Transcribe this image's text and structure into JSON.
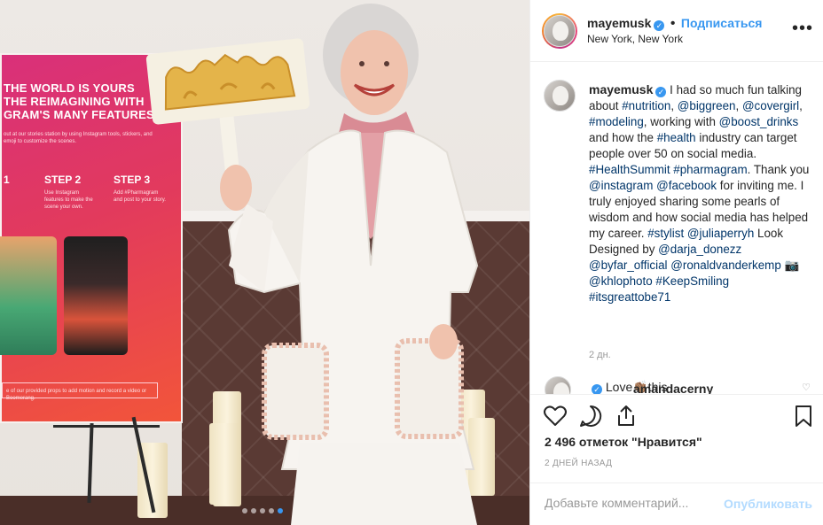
{
  "post": {
    "username": "mayemusk",
    "follow_label": "Подписаться",
    "separator": "•",
    "location": "New York, New York",
    "more_label": "•••"
  },
  "caption": {
    "username": "mayemusk",
    "segments": [
      {
        "t": "I had so much fun talking about "
      },
      {
        "t": "#nutrition",
        "link": true
      },
      {
        "t": ", "
      },
      {
        "t": "@biggreen",
        "link": true
      },
      {
        "t": ", "
      },
      {
        "t": "@covergirl",
        "link": true
      },
      {
        "t": ", "
      },
      {
        "t": "#modeling",
        "link": true
      },
      {
        "t": ", working with "
      },
      {
        "t": "@boost_drinks",
        "link": true
      },
      {
        "t": " and how the "
      },
      {
        "t": "#health",
        "link": true
      },
      {
        "t": " industry can target people over 50 on social media. "
      },
      {
        "t": "#HealthSummit",
        "link": true
      },
      {
        "t": " "
      },
      {
        "t": "#pharmagram",
        "link": true
      },
      {
        "t": ". Thank you "
      },
      {
        "t": "@instagram",
        "link": true
      },
      {
        "t": " "
      },
      {
        "t": "@facebook",
        "link": true
      },
      {
        "t": " for inviting me. I truly enjoyed sharing some pearls of wisdom and how social media has helped my career. "
      },
      {
        "t": "#stylist",
        "link": true
      },
      {
        "t": " "
      },
      {
        "t": "@juliaperryh",
        "link": true
      },
      {
        "t": " Look Designed by "
      },
      {
        "t": "@darja_donezz",
        "link": true
      },
      {
        "t": " "
      },
      {
        "t": "@byfar_official",
        "link": true
      },
      {
        "t": " "
      },
      {
        "t": "@ronaldvanderkemp",
        "link": true
      },
      {
        "t": " 📷 "
      },
      {
        "t": "@khlophoto",
        "link": true
      },
      {
        "t": " "
      },
      {
        "t": "#KeepSmiling",
        "link": true
      },
      {
        "t": " "
      },
      {
        "t": "#itsgreattobe71",
        "link": true
      }
    ],
    "time_ago": "2 дн."
  },
  "reply": {
    "username": "amandacerny",
    "text": "Love👏🏽this"
  },
  "likes_text": "2 496 отметок \"Нравится\"",
  "date_text": "2 ДНЕЙ НАЗАД",
  "composer": {
    "placeholder": "Добавьте комментарий...",
    "publish_label": "Опубликовать"
  },
  "poster": {
    "headline_1": "THE WORLD IS YOURS",
    "headline_2": "THE REIMAGINING WITH",
    "headline_3": "GRAM'S MANY FEATURES",
    "intro": "out at our stories station by using Instagram tools, stickers, and emoji to customize the scenes.",
    "step_1_num": "1",
    "step_2": "STEP 2",
    "step_3": "STEP 3",
    "step_2_text": "Use Instagram features to make the scene your own.",
    "step_3_text": "Add #Pharmagram and post to your story.",
    "bottom_text": "e of our provided props to add motion and record a video or Boomerang."
  },
  "carousel": {
    "count": 5,
    "active_index": 4
  },
  "colors": {
    "accent": "#3897f0",
    "link": "#003569",
    "muted": "#999999",
    "verified": "#3897f0"
  },
  "icons": [
    "heart-icon",
    "comment-icon",
    "share-icon",
    "bookmark-icon",
    "more-icon",
    "verified-icon",
    "camera-emoji"
  ]
}
